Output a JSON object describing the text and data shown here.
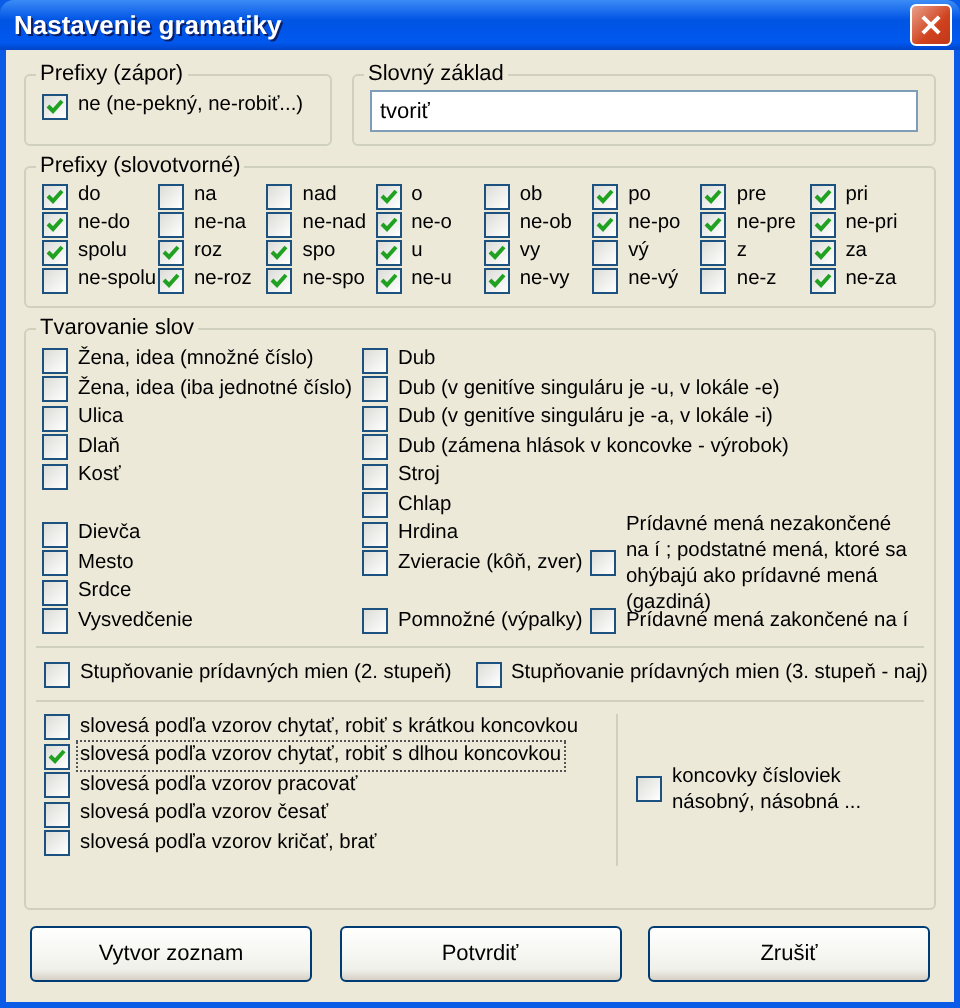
{
  "window": {
    "title": "Nastavenie gramatiky"
  },
  "prefixy_zapor": {
    "label": "Prefixy (zápor)",
    "option": {
      "label": "ne (ne-pekný, ne-robiť...)",
      "checked": true
    }
  },
  "slovny_zaklad": {
    "label": "Slovný základ",
    "value": "tvoriť"
  },
  "prefixy_slovotvorne": {
    "label": "Prefixy (slovotvorné)",
    "options": [
      {
        "label": "do",
        "checked": true
      },
      {
        "label": "na",
        "checked": false
      },
      {
        "label": "nad",
        "checked": false
      },
      {
        "label": "o",
        "checked": true
      },
      {
        "label": "ob",
        "checked": false
      },
      {
        "label": "po",
        "checked": true
      },
      {
        "label": "pre",
        "checked": true
      },
      {
        "label": "pri",
        "checked": true
      },
      {
        "label": "ne-do",
        "checked": true
      },
      {
        "label": "ne-na",
        "checked": false
      },
      {
        "label": "ne-nad",
        "checked": false
      },
      {
        "label": "ne-o",
        "checked": true
      },
      {
        "label": "ne-ob",
        "checked": false
      },
      {
        "label": "ne-po",
        "checked": true
      },
      {
        "label": "ne-pre",
        "checked": true
      },
      {
        "label": "ne-pri",
        "checked": true
      },
      {
        "label": "spolu",
        "checked": true
      },
      {
        "label": "roz",
        "checked": true
      },
      {
        "label": "spo",
        "checked": true
      },
      {
        "label": "u",
        "checked": true
      },
      {
        "label": "vy",
        "checked": true
      },
      {
        "label": "vý",
        "checked": false
      },
      {
        "label": "z",
        "checked": false
      },
      {
        "label": "za",
        "checked": true
      },
      {
        "label": "ne-spolu",
        "checked": false
      },
      {
        "label": "ne-roz",
        "checked": true
      },
      {
        "label": "ne-spo",
        "checked": true
      },
      {
        "label": "ne-u",
        "checked": true
      },
      {
        "label": "ne-vy",
        "checked": true
      },
      {
        "label": "ne-vý",
        "checked": false
      },
      {
        "label": "ne-z",
        "checked": false
      },
      {
        "label": "ne-za",
        "checked": true
      }
    ]
  },
  "tvarovanie_slov": {
    "label": "Tvarovanie slov",
    "column_1": [
      {
        "label": "Žena, idea (množné číslo)",
        "checked": false
      },
      {
        "label": "Žena, idea (iba jednotné číslo)",
        "checked": false
      },
      {
        "label": "Ulica",
        "checked": false
      },
      {
        "label": "Dlaň",
        "checked": false
      },
      {
        "label": "Kosť",
        "checked": false
      },
      {
        "label": "Dievča",
        "checked": false
      },
      {
        "label": "Mesto",
        "checked": false
      },
      {
        "label": "Srdce",
        "checked": false
      },
      {
        "label": "Vysvedčenie",
        "checked": false
      }
    ],
    "column_2": [
      {
        "label": "Dub",
        "checked": false
      },
      {
        "label": "Dub (v genitíve singuláru je -u, v lokále -e)",
        "checked": false
      },
      {
        "label": "Dub (v genitíve singuláru je -a, v lokále -i)",
        "checked": false
      },
      {
        "label": "Dub (zámena hlások v koncovke - výrobok)",
        "checked": false
      },
      {
        "label": "Stroj",
        "checked": false
      },
      {
        "label": "Chlap",
        "checked": false
      },
      {
        "label": "Hrdina",
        "checked": false
      },
      {
        "label": "Zvieracie (kôň, zver)",
        "checked": false
      },
      {
        "label": "Pomnožné (výpalky)",
        "checked": false
      }
    ],
    "column_3": [
      {
        "label": "Prídavné mená nezakončené na í ; podstatné mená, ktoré sa ohýbajú ako prídavné mená (gazdiná)",
        "checked": false
      },
      {
        "label": "Prídavné mená zakončené na í",
        "checked": false
      }
    ],
    "stupnovanie": [
      {
        "label": "Stupňovanie prídavných mien (2. stupeň)",
        "checked": false
      },
      {
        "label": "Stupňovanie prídavných mien (3. stupeň - naj)",
        "checked": false
      }
    ],
    "slovesa": [
      {
        "label": "slovesá podľa vzorov chytať, robiť s krátkou koncovkou",
        "checked": false,
        "focused": false
      },
      {
        "label": "slovesá podľa vzorov chytať, robiť s dlhou koncovkou",
        "checked": true,
        "focused": true
      },
      {
        "label": "slovesá podľa vzorov pracovať",
        "checked": false,
        "focused": false
      },
      {
        "label": "slovesá podľa vzorov česať",
        "checked": false,
        "focused": false
      },
      {
        "label": "slovesá podľa vzorov kričať, brať",
        "checked": false,
        "focused": false
      }
    ],
    "cislovky": {
      "label": "koncovky čísloviek násobný, násobná ...",
      "checked": false
    }
  },
  "buttons": [
    "Vytvor zoznam",
    "Potvrdiť",
    "Zrušiť"
  ]
}
